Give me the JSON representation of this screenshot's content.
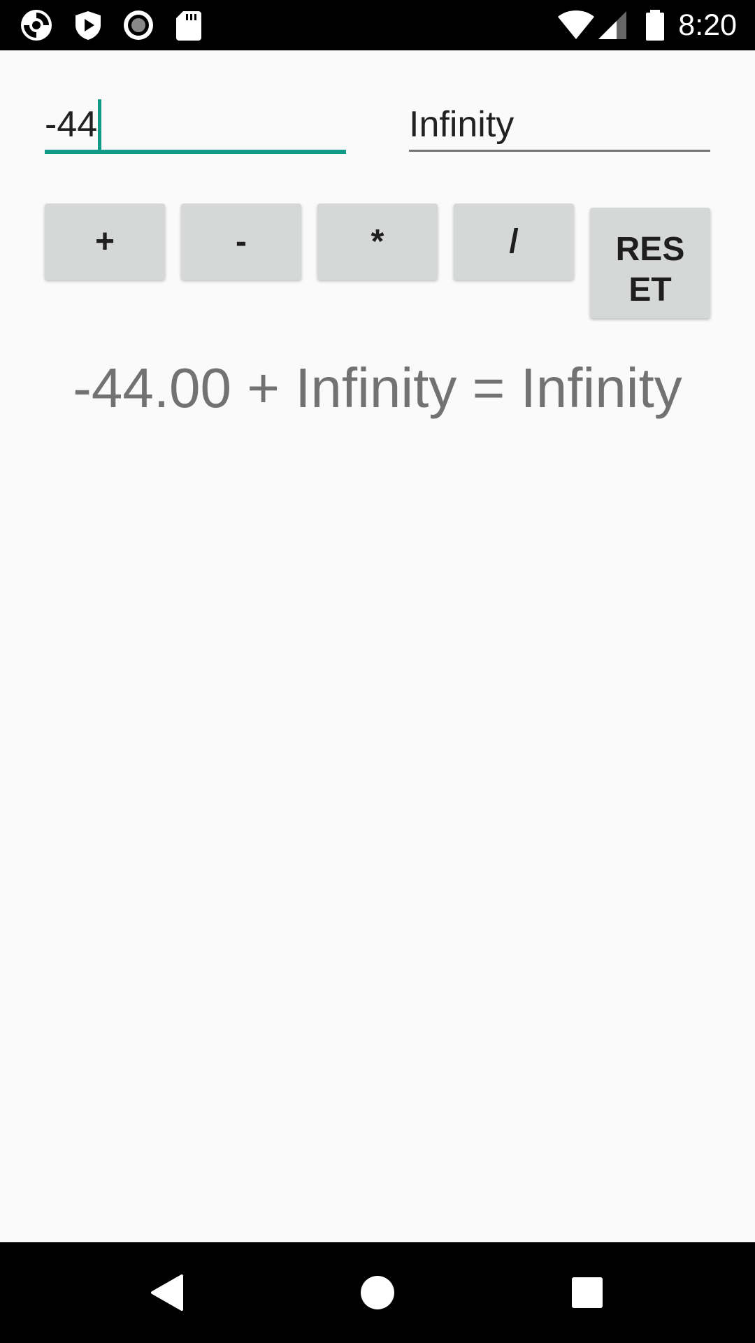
{
  "status_bar": {
    "time": "8:20",
    "icons_left": [
      "app-swirl-icon",
      "shield-play-icon",
      "record-icon",
      "sd-card-icon"
    ],
    "icons_right": [
      "wifi-icon",
      "signal-icon",
      "battery-icon"
    ]
  },
  "inputs": {
    "first_value": "-44",
    "second_value": "Infinity",
    "accent_color": "#139b8a"
  },
  "buttons": {
    "add": "+",
    "subtract": "-",
    "multiply": "*",
    "divide": "/",
    "reset": "RESET"
  },
  "result": {
    "text": "-44.00 + Infinity = Infinity"
  },
  "nav_bar": {
    "icons": [
      "back-icon",
      "home-icon",
      "recents-icon"
    ]
  }
}
